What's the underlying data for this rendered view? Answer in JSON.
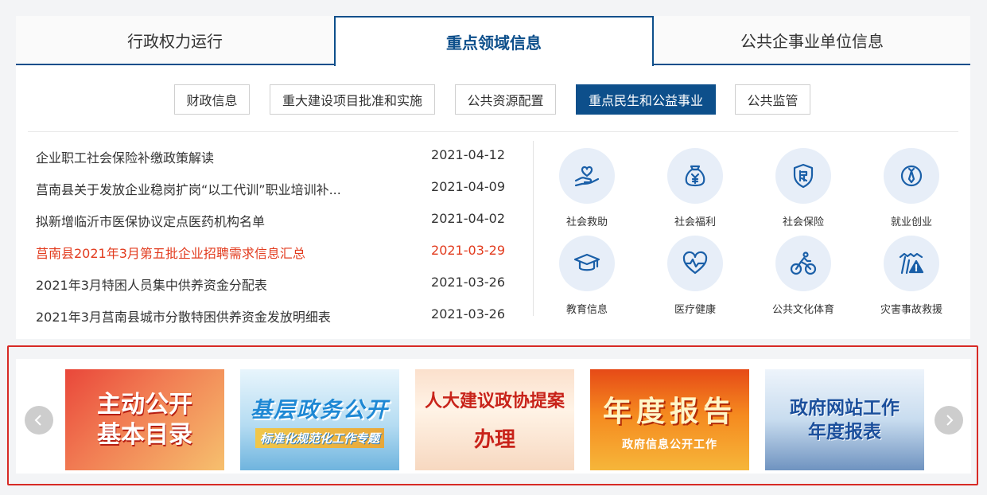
{
  "tabs": [
    {
      "label": "行政权力运行"
    },
    {
      "label": "重点领域信息"
    },
    {
      "label": "公共企事业单位信息"
    }
  ],
  "subtabs": [
    {
      "label": "财政信息"
    },
    {
      "label": "重大建设项目批准和实施"
    },
    {
      "label": "公共资源配置"
    },
    {
      "label": "重点民生和公益事业"
    },
    {
      "label": "公共监管"
    }
  ],
  "news": [
    {
      "title": "企业职工社会保险补缴政策解读",
      "date": "2021-04-12"
    },
    {
      "title": "莒南县关于发放企业稳岗扩岗“以工代训”职业培训补...",
      "date": "2021-04-09"
    },
    {
      "title": "拟新增临沂市医保协议定点医药机构名单",
      "date": "2021-04-02"
    },
    {
      "title": "莒南县2021年3月第五批企业招聘需求信息汇总",
      "date": "2021-03-29"
    },
    {
      "title": "2021年3月特困人员集中供养资金分配表",
      "date": "2021-03-26"
    },
    {
      "title": "2021年3月莒南县城市分散特困供养资金发放明细表",
      "date": "2021-03-26"
    }
  ],
  "categories": [
    {
      "label": "社会救助",
      "icon": "heart-hand-icon"
    },
    {
      "label": "社会福利",
      "icon": "money-bag-icon"
    },
    {
      "label": "社会保险",
      "icon": "insurance-shield-icon"
    },
    {
      "label": "就业创业",
      "icon": "tie-badge-icon"
    },
    {
      "label": "教育信息",
      "icon": "graduation-cap-icon"
    },
    {
      "label": "医疗健康",
      "icon": "heartbeat-icon"
    },
    {
      "label": "公共文化体育",
      "icon": "cyclist-icon"
    },
    {
      "label": "灾害事故救援",
      "icon": "disaster-warning-icon"
    }
  ],
  "banners": {
    "b1": {
      "line1": "主动公开",
      "line2": "基本目录"
    },
    "b2": {
      "line1": "基层政务公开",
      "line2": "标准化规范化工作专题"
    },
    "b3": {
      "line1": "人大建议政协提案",
      "line2": "办理"
    },
    "b4": {
      "line1": "年度报告",
      "line2": "政府信息公开工作"
    },
    "b5": {
      "line1": "政府网站工作",
      "line2": "年度报表"
    }
  },
  "colors": {
    "accent": "#0d4f8b",
    "highlight": "#e23b1e",
    "carousel_border": "#d72a25"
  }
}
